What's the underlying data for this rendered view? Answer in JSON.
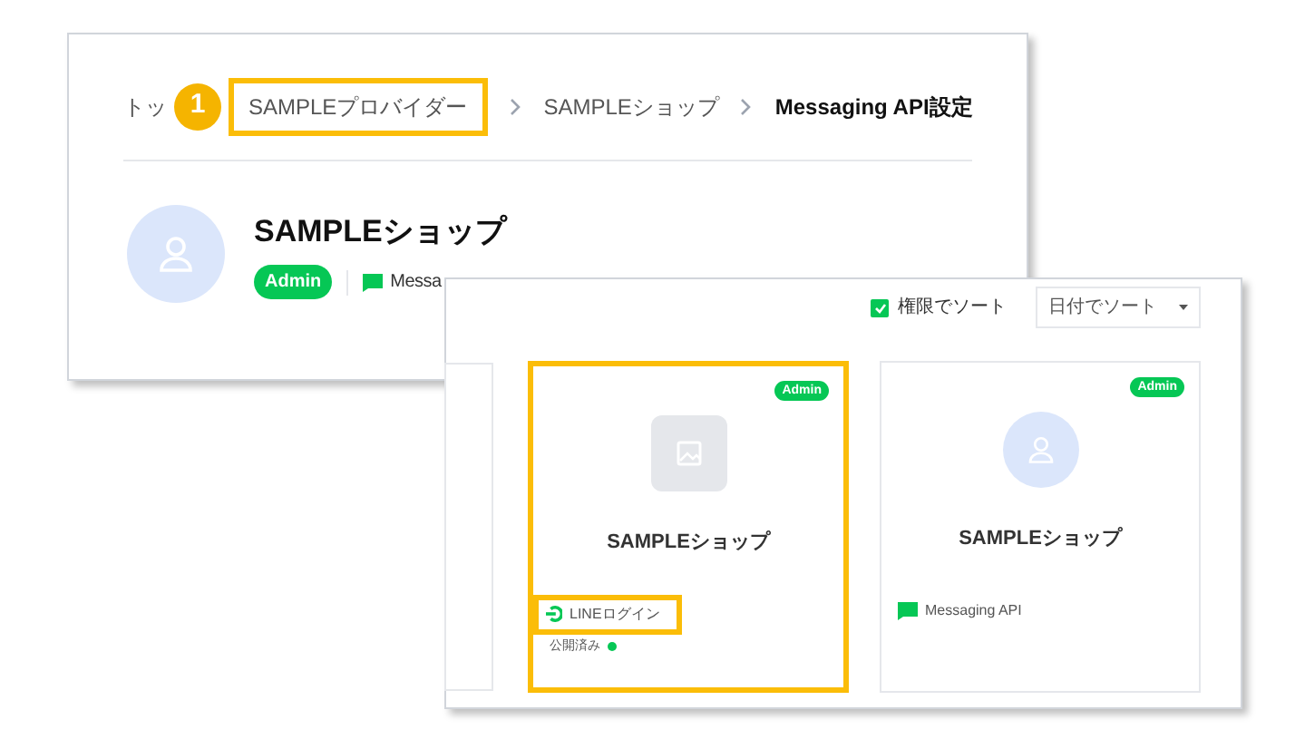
{
  "detail_window": {
    "breadcrumb": [
      {
        "label": "トッ",
        "current": false,
        "highlighted": false
      },
      {
        "label": "SAMPLEプロバイダー",
        "current": false,
        "highlighted": true,
        "callout": "1"
      },
      {
        "label": "SAMPLEショップ",
        "current": false,
        "highlighted": false
      },
      {
        "label": "Messaging API設定",
        "current": true,
        "highlighted": false
      }
    ],
    "channel": {
      "name": "SAMPLEショップ",
      "role": "Admin",
      "service": "Messa"
    }
  },
  "list_window": {
    "sort_by_role": {
      "label": "権限でソート",
      "checked": true
    },
    "sort_select": {
      "value": "日付でソート"
    },
    "cards": [
      {
        "kind": "partial"
      },
      {
        "kind": "image",
        "name": "SAMPLEショップ",
        "role": "Admin",
        "highlighted": true,
        "service": {
          "kind": "login",
          "label": "LINEログイン",
          "highlighted": true
        },
        "status": {
          "label": "公開済み",
          "color": "#06c755"
        }
      },
      {
        "kind": "avatar",
        "name": "SAMPLEショップ",
        "role": "Admin",
        "highlighted": false,
        "service": {
          "kind": "messaging",
          "label": "Messaging API",
          "highlighted": false
        }
      }
    ]
  }
}
